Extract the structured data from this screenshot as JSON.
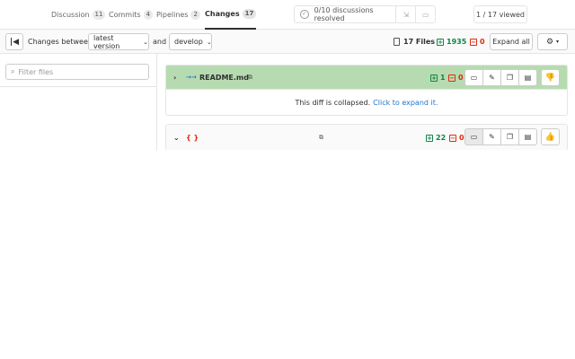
{
  "tabs": [
    {
      "label": "Discussion",
      "count": "11"
    },
    {
      "label": "Commits",
      "count": "4"
    },
    {
      "label": "Pipelines",
      "count": "2"
    },
    {
      "label": "Changes",
      "count": "17"
    }
  ],
  "discussions": {
    "resolved_text": "0/10 discussions resolved"
  },
  "viewed": "1 / 17 viewed",
  "compare": {
    "label": "Changes between",
    "source": "latest version",
    "and_label": "and",
    "target": "develop"
  },
  "stats": {
    "files": "17 Files",
    "additions": "1935",
    "deletions": "0"
  },
  "expand_all_label": "Expand all",
  "sidebar": {
    "filter_placeholder": "Filter files"
  },
  "diffs": [
    {
      "icon": "→→",
      "name": "README.md",
      "additions": "1",
      "deletions": "0",
      "collapsed_text": "This diff is collapsed.",
      "expand_link": "Click to expand it."
    },
    {
      "icon": "{ }",
      "name": "",
      "additions": "22",
      "deletions": "0"
    }
  ],
  "colors": {
    "addition": "#108548",
    "deletion": "#dd2b0e",
    "link": "#1f75cb",
    "viewed_header": "#b7dbb0"
  }
}
